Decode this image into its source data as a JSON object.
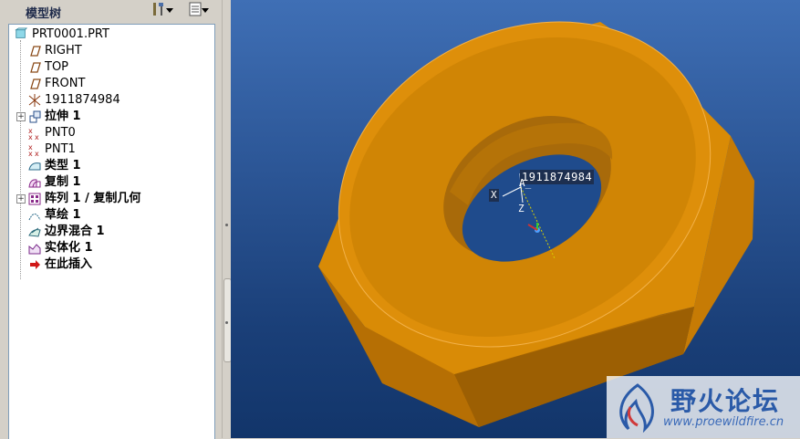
{
  "panel": {
    "title": "模型树"
  },
  "tree": {
    "items": [
      {
        "label": "PRT0001.PRT",
        "icon": "part-icon",
        "cjk": false
      },
      {
        "label": "RIGHT",
        "icon": "datum-plane-icon",
        "cjk": false
      },
      {
        "label": "TOP",
        "icon": "datum-plane-icon",
        "cjk": false
      },
      {
        "label": "FRONT",
        "icon": "datum-plane-icon",
        "cjk": false
      },
      {
        "label": "1911874984",
        "icon": "coordinate-system-icon",
        "cjk": false
      },
      {
        "label": "拉伸 1",
        "icon": "extrude-icon",
        "cjk": true
      },
      {
        "label": "PNT0",
        "icon": "datum-point-icon",
        "cjk": false
      },
      {
        "label": "PNT1",
        "icon": "datum-point-icon",
        "cjk": false
      },
      {
        "label": "类型 1",
        "icon": "surface-icon",
        "cjk": true
      },
      {
        "label": "复制 1",
        "icon": "copy-icon",
        "cjk": true
      },
      {
        "label": "阵列 1 / 复制几何",
        "icon": "pattern-icon",
        "cjk": true
      },
      {
        "label": "草绘 1",
        "icon": "sketch-icon",
        "cjk": true
      },
      {
        "label": "边界混合 1",
        "icon": "boundary-blend-icon",
        "cjk": true
      },
      {
        "label": "实体化 1",
        "icon": "solidify-icon",
        "cjk": true
      },
      {
        "label": "在此插入",
        "icon": "insert-here-icon",
        "cjk": true
      }
    ]
  },
  "viewport": {
    "csys_label": "1911874984",
    "axis_x": "X",
    "axis_a": "A_",
    "axis_z": "Z"
  },
  "watermark": {
    "title": "野火论坛",
    "url": "www.proewildfire.cn"
  },
  "colors": {
    "nut_face": "#d88a06",
    "nut_side_dark": "#b06e05",
    "nut_side_light": "#e79b10",
    "viewport_bg_top": "#3f6fb5",
    "viewport_bg_bottom": "#12356a"
  }
}
